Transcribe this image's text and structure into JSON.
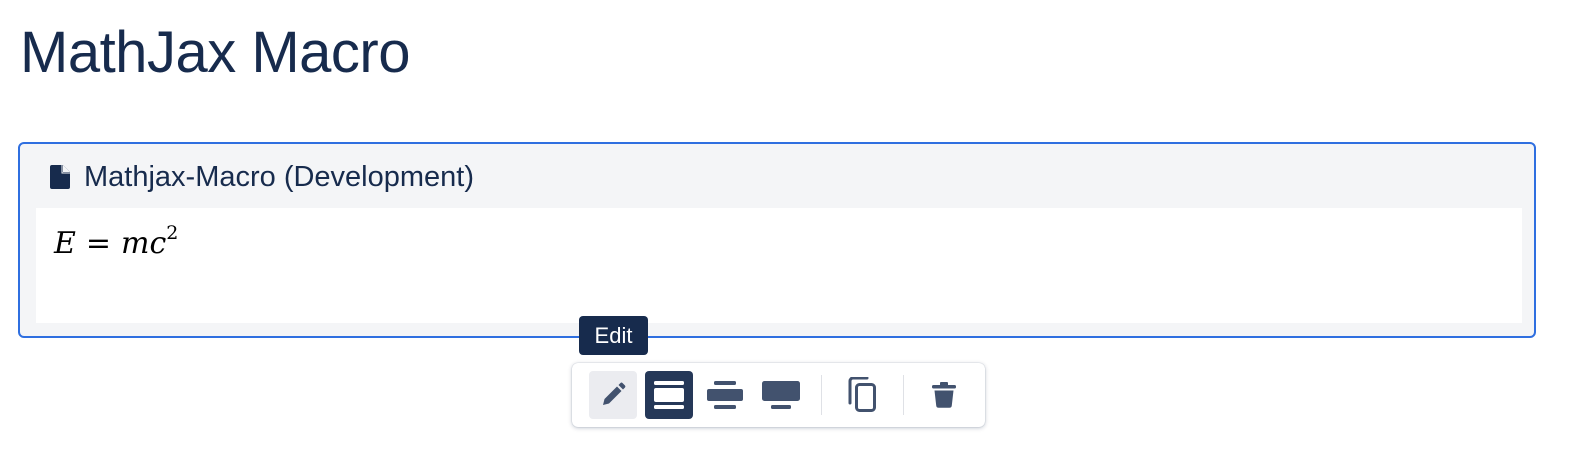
{
  "page": {
    "title": "MathJax Macro"
  },
  "macro": {
    "title": "Mathjax-Macro (Development)",
    "header_icon": "document-icon",
    "formula": {
      "lhs": "E",
      "eq": "=",
      "rhs": "mc",
      "exponent": "2"
    },
    "border_color": "#2F6FE0"
  },
  "tooltip": {
    "text": "Edit"
  },
  "toolbar": {
    "buttons": [
      {
        "name": "edit",
        "icon": "pencil-icon",
        "state": "hover"
      },
      {
        "name": "layout-full-width",
        "icon": "full-width-icon",
        "state": "selected"
      },
      {
        "name": "layout-center",
        "icon": "center-align-icon",
        "state": "default"
      },
      {
        "name": "layout-wide",
        "icon": "wide-display-icon",
        "state": "default"
      },
      {
        "name": "copy",
        "icon": "copy-icon",
        "state": "default"
      },
      {
        "name": "delete",
        "icon": "trash-icon",
        "state": "default"
      }
    ],
    "colors": {
      "icon": "#42526E",
      "selected_bg": "#253858",
      "hover_bg": "#EBECF0"
    }
  }
}
